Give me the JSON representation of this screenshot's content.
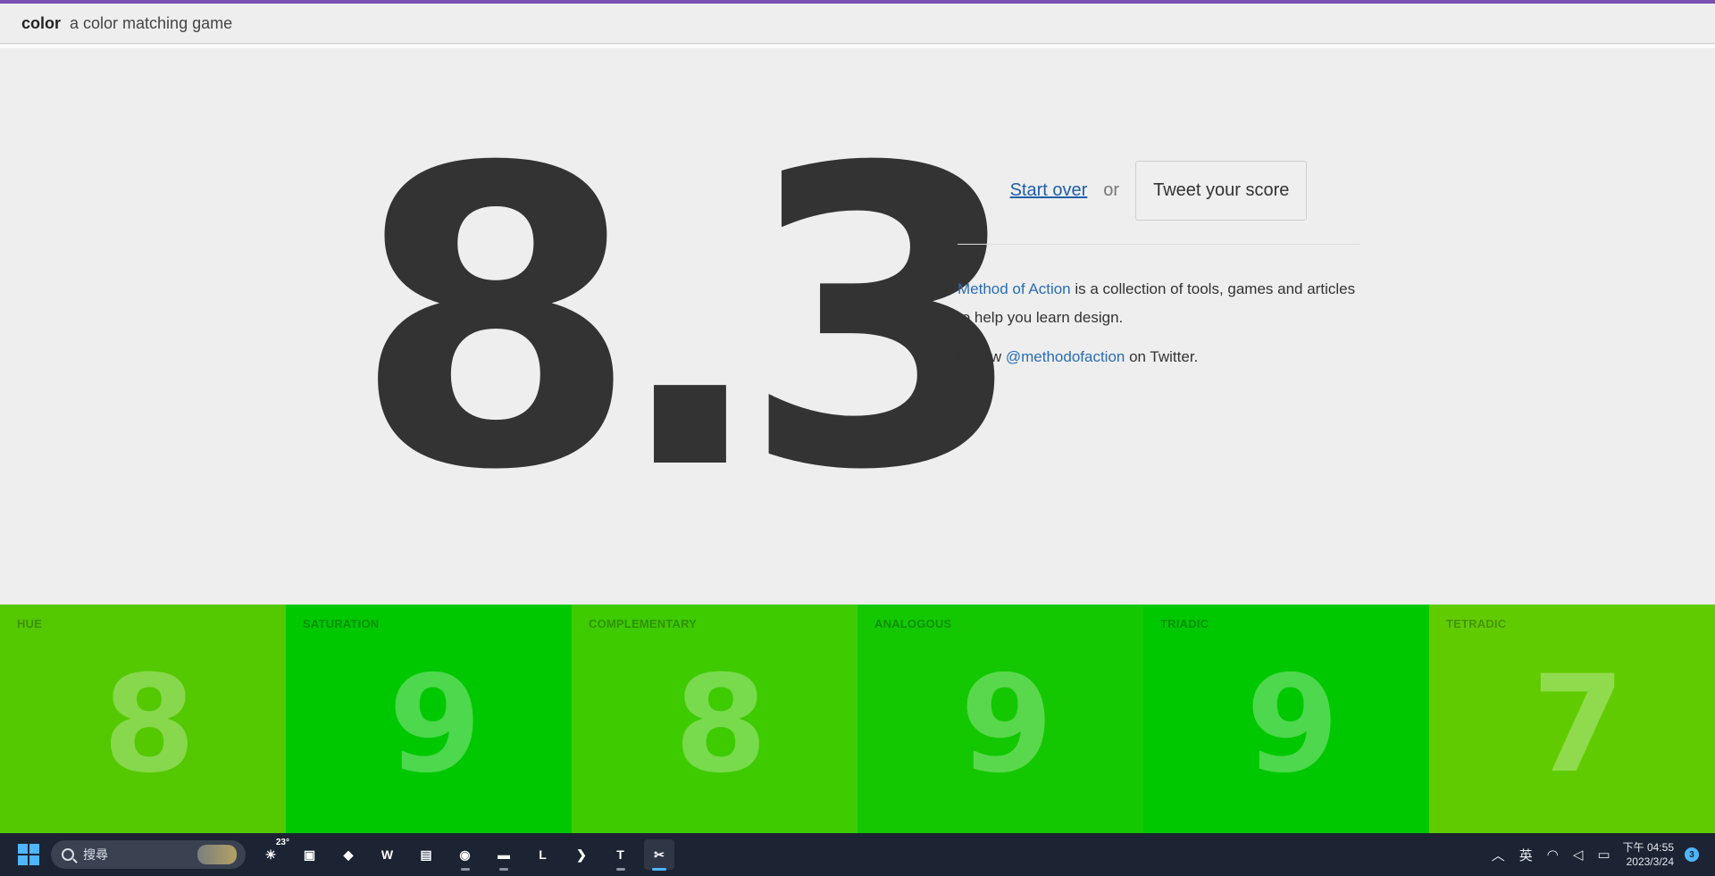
{
  "header": {
    "brand": "color",
    "tagline": "a color matching game",
    "accent": "#7a4fb5"
  },
  "score": {
    "value": "8.3"
  },
  "actions": {
    "start_over": "Start over",
    "or": "or",
    "tweet": "Tweet your score"
  },
  "about": {
    "link": "Method of Action",
    "text": " is a collection of tools, games and articles to help you learn design.",
    "follow_prefix": "Follow ",
    "follow_handle": "@methodofaction",
    "follow_suffix": " on Twitter."
  },
  "tiles": [
    {
      "label": "HUE",
      "score": "8",
      "color": "#54c800"
    },
    {
      "label": "SATURATION",
      "score": "9",
      "color": "#00c800"
    },
    {
      "label": "COMPLEMENTARY",
      "score": "8",
      "color": "#3ecb00"
    },
    {
      "label": "ANALOGOUS",
      "score": "9",
      "color": "#13c800"
    },
    {
      "label": "TRIADIC",
      "score": "9",
      "color": "#00c800"
    },
    {
      "label": "TETRADIC",
      "score": "7",
      "color": "#60cc00"
    }
  ],
  "taskbar": {
    "search_placeholder": "搜尋",
    "weather_temp": "23°",
    "apps": [
      {
        "name": "weather-icon",
        "glyph": "☀"
      },
      {
        "name": "photos-icon",
        "glyph": "▣"
      },
      {
        "name": "game-icon",
        "glyph": "◆"
      },
      {
        "name": "word-icon",
        "glyph": "W"
      },
      {
        "name": "notepad-icon",
        "glyph": "▤"
      },
      {
        "name": "chrome-icon",
        "glyph": "◉"
      },
      {
        "name": "file-explorer-icon",
        "glyph": "▬"
      },
      {
        "name": "line-icon",
        "glyph": "L"
      },
      {
        "name": "vscode-icon",
        "glyph": "❯"
      },
      {
        "name": "teams-icon",
        "glyph": "T"
      },
      {
        "name": "snipping-tool-icon",
        "glyph": "✂"
      }
    ],
    "ime": "英",
    "time": "下午 04:55",
    "date": "2023/3/24",
    "notifications": "3"
  }
}
